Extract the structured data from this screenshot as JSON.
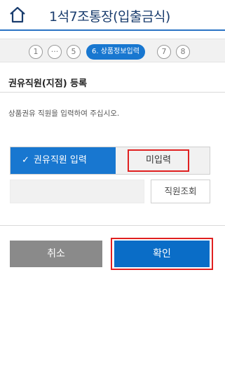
{
  "header": {
    "title": "1석7조통장(입출금식)"
  },
  "steps": {
    "items": [
      "1",
      "···",
      "5"
    ],
    "current": "6. 상품정보입력",
    "after": [
      "7",
      "8"
    ]
  },
  "section": {
    "title": "권유직원(지점) 등록",
    "description": "상품권유 직원을 입력하여 주십시오."
  },
  "toggle": {
    "on_label": "권유직원 입력",
    "off_label": "미입력",
    "selected": "권유직원 입력"
  },
  "staff": {
    "input_value": "",
    "search_label": "직원조회"
  },
  "actions": {
    "cancel_label": "취소",
    "confirm_label": "확인"
  },
  "colors": {
    "accent": "#1877d0",
    "highlight": "#e02020",
    "cancel": "#8a8a8a"
  },
  "icons": {
    "home": "home-icon",
    "check": "check-icon"
  }
}
